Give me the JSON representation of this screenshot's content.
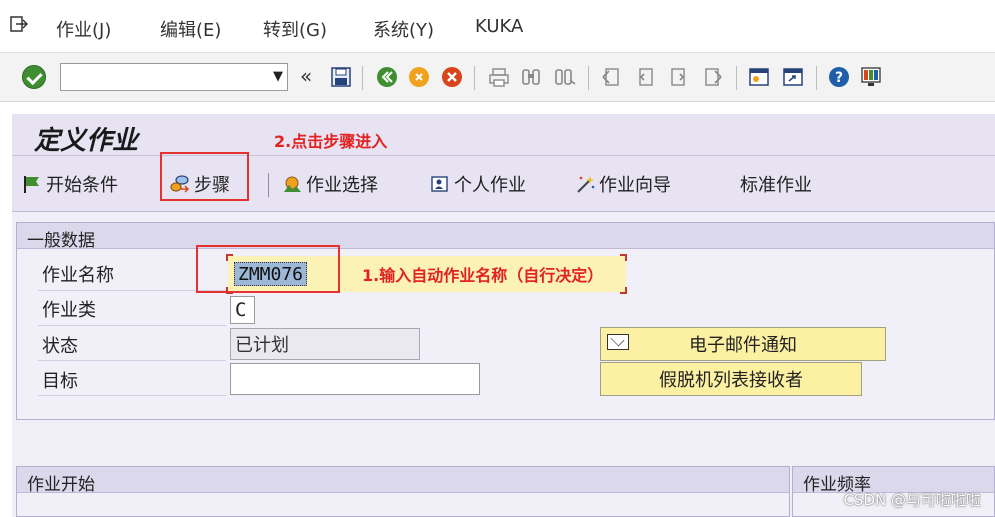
{
  "menu": {
    "items": [
      "作业(J)",
      "编辑(E)",
      "转到(G)",
      "系统(Y)",
      "KUKA"
    ]
  },
  "toolbar": {
    "command_field_value": "",
    "back_glyph": "«"
  },
  "title": {
    "text": "定义作业",
    "annotation": "2.点击步骤进入"
  },
  "app_toolbar": {
    "start_condition": "开始条件",
    "steps": "步骤",
    "job_selection": "作业选择",
    "own_jobs": "个人作业",
    "job_wizard": "作业向导",
    "standard_jobs": "标准作业"
  },
  "general_data": {
    "title": "一般数据",
    "job_name_label": "作业名称",
    "job_name_value": "ZMM076",
    "job_name_annotation": "1.输入自动作业名称（自行决定）",
    "job_class_label": "作业类",
    "job_class_value": "C",
    "status_label": "状态",
    "status_value": "已计划",
    "target_label": "目标",
    "target_value": "",
    "email_button": "电子邮件通知",
    "spool_button": "假脱机列表接收者"
  },
  "bottom": {
    "job_start": "作业开始",
    "job_frequency": "作业频率"
  },
  "watermark": "CSDN @与可啦啦啦",
  "colors": {
    "annotation_red": "#e32222",
    "title_bar": "#e7e3f3",
    "yellow_button": "#fcf0a3",
    "selection_blue": "#9cb8d6"
  }
}
